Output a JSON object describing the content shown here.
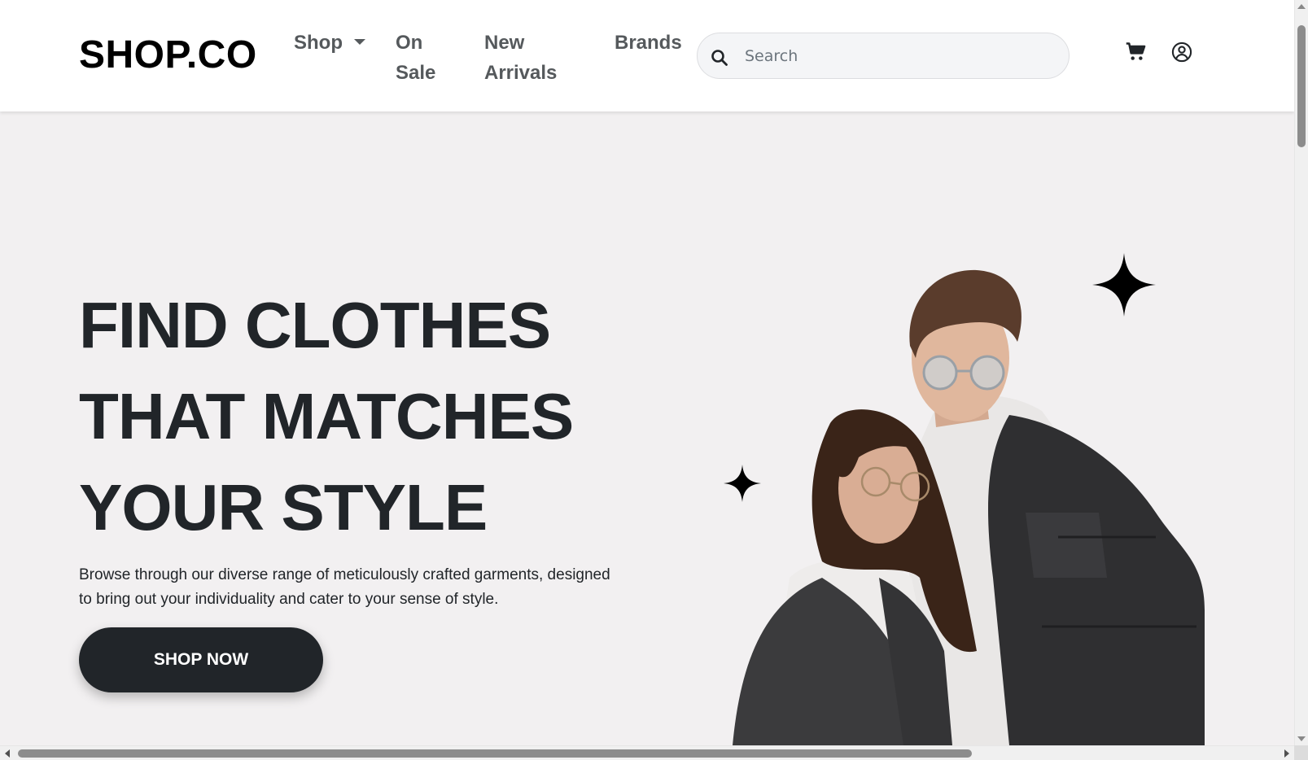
{
  "header": {
    "logo": "SHOP.CO",
    "nav": {
      "shop": "Shop",
      "on_sale": "On Sale",
      "new_arrivals": "New Arrivals",
      "brands": "Brands"
    },
    "search": {
      "placeholder": "Search",
      "value": ""
    },
    "icons": [
      "search-icon",
      "cart-icon",
      "user-circle-icon",
      "caret-down-icon"
    ]
  },
  "hero": {
    "title_lines": [
      "FIND CLOTHES",
      "THAT MATCHES",
      "YOUR STYLE"
    ],
    "description": "Browse through our diverse range of meticulously crafted garments, designed to bring out your individuality and cater to your sense of style.",
    "cta": "SHOP NOW",
    "decorations": [
      "sparkle-star-icon",
      "sparkle-star-icon"
    ]
  },
  "colors": {
    "background": "#f2f0f1",
    "header": "#ffffff",
    "text_dark": "#212529",
    "nav_text": "#55595c",
    "button": "#212529"
  }
}
